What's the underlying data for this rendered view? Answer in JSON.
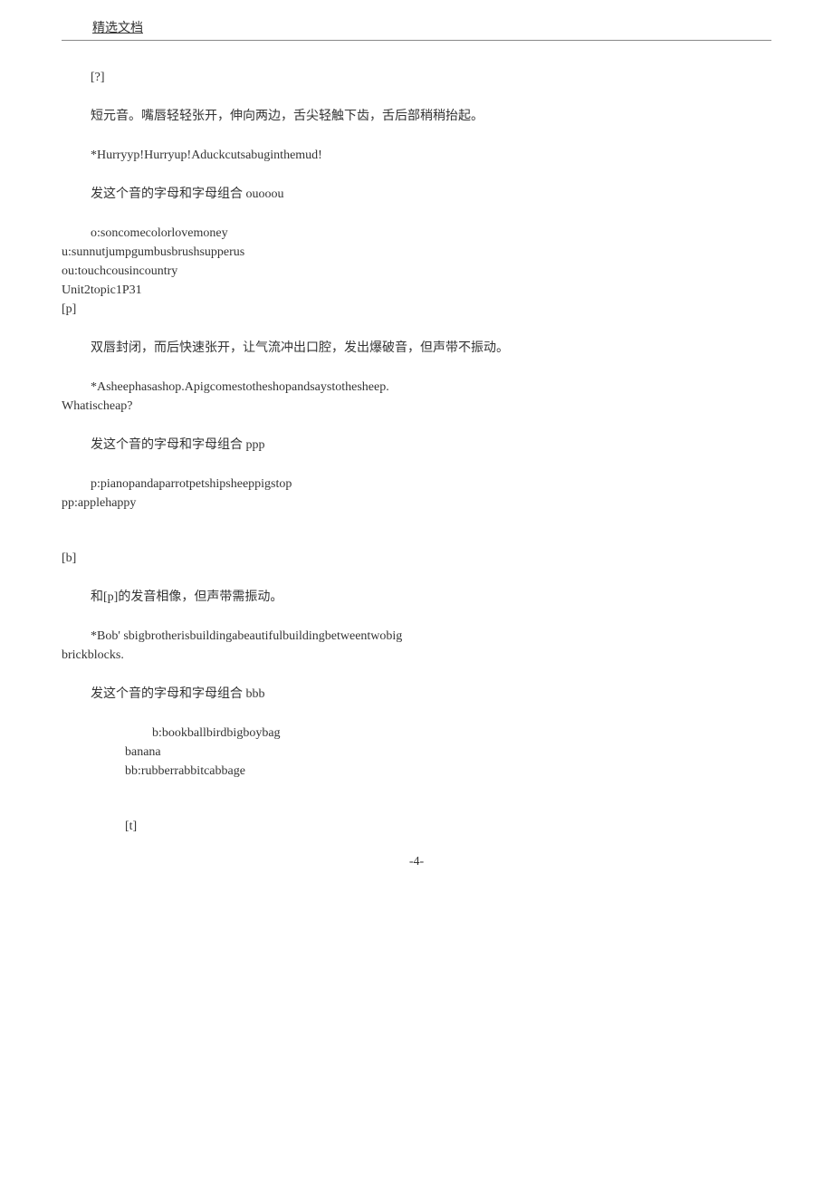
{
  "header": {
    "title": "精选文档"
  },
  "content": {
    "p1": "[?]",
    "p2": "短元音。嘴唇轻轻张开，伸向两边，舌尖轻触下齿，舌后部稍稍抬起。",
    "p3": "*Hurryyp!Hurryup!Aduckcutsabuginthemud!",
    "p4": "发这个音的字母和字母组合 ouooou",
    "p5_l1": "o:soncomecolorlovemoney",
    "p5_l2": "u:sunnutjumpgumbusbrushsupperus",
    "p5_l3": "ou:touchcousincountry",
    "p5_l4": "Unit2topic1P31",
    "p5_l5": "[p]",
    "p6": "双唇封闭，而后快速张开，让气流冲出口腔，发出爆破音，但声带不振动。",
    "p7_l1": "*Asheephasashop.Apigcomestotheshopandsaystothesheep.",
    "p7_l2": "Whatischeap?",
    "p8": "发这个音的字母和字母组合 ppp",
    "p9_l1": "p:pianopandaparrotpetshipsheeppigstop",
    "p9_l2": "pp:applehappy",
    "p10": "[b]",
    "p11": "和[p]的发音相像，但声带需振动。",
    "p12_l1": "*Bob' sbigbrotherisbuildingabeautifulbuildingbetweentwobig",
    "p12_l2": "brickblocks.",
    "p13": "发这个音的字母和字母组合 bbb",
    "p14_l1": "b:bookballbirdbigboybag",
    "p14_l2": "banana",
    "p14_l3": "bb:rubberrabbitcabbage",
    "p15": "[t]"
  },
  "footer": {
    "page_number": "-4-"
  }
}
